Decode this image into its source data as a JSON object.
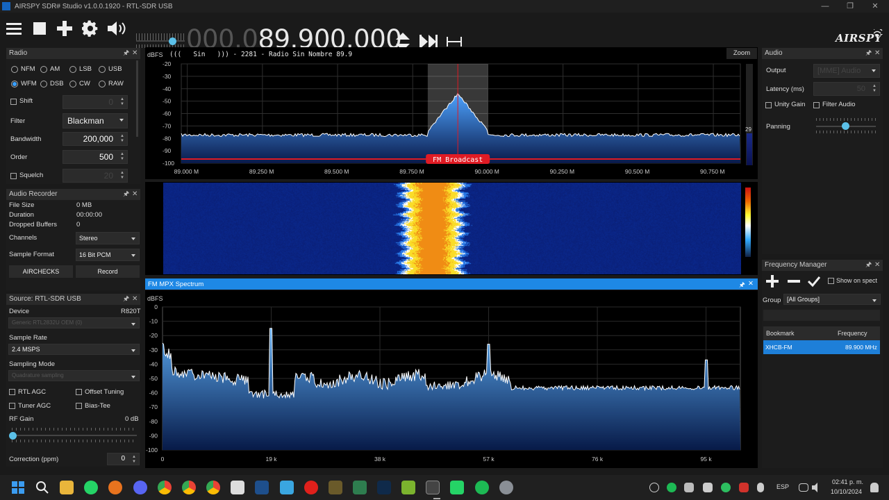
{
  "window": {
    "title": "AIRSPY SDR# Studio v1.0.0.1920 - RTL-SDR USB"
  },
  "frequency": {
    "dim": "000.0",
    "lit": "89.900.000"
  },
  "brand": {
    "logo_text": "AIRSPY"
  },
  "radio": {
    "title": "Radio",
    "modes": [
      {
        "label": "NFM",
        "selected": false
      },
      {
        "label": "AM",
        "selected": false
      },
      {
        "label": "LSB",
        "selected": false
      },
      {
        "label": "USB",
        "selected": false
      },
      {
        "label": "WFM",
        "selected": true
      },
      {
        "label": "DSB",
        "selected": false
      },
      {
        "label": "CW",
        "selected": false
      },
      {
        "label": "RAW",
        "selected": false
      }
    ],
    "shift_label": "Shift",
    "shift_value": "0",
    "filter_label": "Filter",
    "filter_value": "Blackman",
    "bandwidth_label": "Bandwidth",
    "bandwidth_value": "200,000",
    "order_label": "Order",
    "order_value": "500",
    "squelch_label": "Squelch",
    "squelch_value": "20"
  },
  "recorder": {
    "title": "Audio Recorder",
    "file_size_label": "File Size",
    "file_size": "0 MB",
    "duration_label": "Duration",
    "duration": "00:00:00",
    "dropped_label": "Dropped Buffers",
    "dropped": "0",
    "channels_label": "Channels",
    "channels": "Stereo",
    "format_label": "Sample Format",
    "format": "16 Bit PCM",
    "aircheck_label": "AIRCHECKS",
    "record_label": "Record"
  },
  "source": {
    "title": "Source: RTL-SDR USB",
    "device_label": "Device",
    "device_value": "R820T",
    "device_select": "Generic RTL2832U OEM (0)",
    "sample_rate_label": "Sample Rate",
    "sample_rate": "2.4 MSPS",
    "sampling_mode_label": "Sampling Mode",
    "sampling_mode": "Quadrature sampling",
    "rtl_agc": "RTL AGC",
    "offset_tuning": "Offset Tuning",
    "tuner_agc": "Tuner AGC",
    "bias_tee": "Bias-Tee",
    "rf_gain_label": "RF Gain",
    "rf_gain_value": "0 dB",
    "correction_label": "Correction (ppm)",
    "correction_value": "0"
  },
  "spectrum": {
    "unit": "dBFS",
    "rds_text": "(((   Sin   ))) - 2281 - Radio Sin Nombre 89.9",
    "zoom_label": "Zoom",
    "y_ticks": [
      "-20",
      "-30",
      "-40",
      "-50",
      "-60",
      "-70",
      "-80",
      "-90",
      "-100"
    ],
    "x_ticks": [
      "89.000 M",
      "89.250 M",
      "89.500 M",
      "89.750 M",
      "90.000 M",
      "90.250 M",
      "90.500 M",
      "90.750 M"
    ],
    "band_label": "FM Broadcast",
    "side_value": "29"
  },
  "mpx": {
    "title": "FM MPX Spectrum",
    "unit": "dBFS",
    "y_ticks": [
      "0",
      "-10",
      "-20",
      "-30",
      "-40",
      "-50",
      "-60",
      "-70",
      "-80",
      "-90",
      "-100"
    ],
    "x_ticks": [
      "0",
      "19 k",
      "38 k",
      "57 k",
      "76 k",
      "95 k"
    ]
  },
  "audio": {
    "title": "Audio",
    "output_label": "Output",
    "output_value": "[MME] Audio",
    "latency_label": "Latency (ms)",
    "latency_value": "50",
    "unity_gain": "Unity Gain",
    "filter_audio": "Filter Audio",
    "panning_label": "Panning"
  },
  "freqmgr": {
    "title": "Frequency Manager",
    "show_on_spectrum": "Show on spect",
    "group_label": "Group",
    "group_value": "[All Groups]",
    "col_bookmark": "Bookmark",
    "col_frequency": "Frequency",
    "rows": [
      {
        "name": "XHCB-FM",
        "freq": "89.900 MHz"
      }
    ]
  },
  "taskbar": {
    "lang": "ESP",
    "time": "02:41 p. m.",
    "date": "10/10/2024"
  },
  "colors": {
    "accent": "#1e88e5",
    "band_red": "#e01b24",
    "selected_row": "#1e7fd8"
  }
}
